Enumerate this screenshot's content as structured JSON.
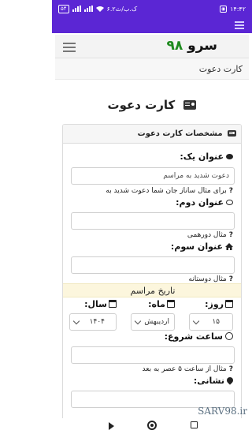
{
  "status_bar": {
    "time": "۱۴:۴۲",
    "speed": "۶.۲ک.ب/ث",
    "battery": "۵۴"
  },
  "brand": {
    "name": "سرو",
    "number": "۹۸"
  },
  "breadcrumb": "کارت دعوت",
  "page_title": "کارت دعوت",
  "card": {
    "header": "مشخصات کارت دعوت",
    "title1": {
      "label": "عنوان یک:",
      "value": "دعوت شدید به مراسم",
      "hint": "برای مثال ساناز جان شما دعوت شدید به"
    },
    "title2": {
      "label": "عنوان دوم:",
      "value": "",
      "hint": "مثال دورهمی"
    },
    "title3": {
      "label": "عنوان سوم:",
      "value": "",
      "hint": "مثال دوستانه"
    },
    "ceremony_date": "تاریخ مراسم",
    "day": {
      "label": "روز:",
      "value": "۱۵"
    },
    "month": {
      "label": "ماه:",
      "value": "اردیبهش"
    },
    "year": {
      "label": "سال:",
      "value": "۱۴۰۴"
    },
    "start_time": {
      "label": "ساعت شروع:",
      "value": "",
      "hint": "مثال از ساعت ۵ عصر به بعد"
    },
    "address": {
      "label": "نشانی:"
    }
  },
  "watermark": "SARV98.ir"
}
